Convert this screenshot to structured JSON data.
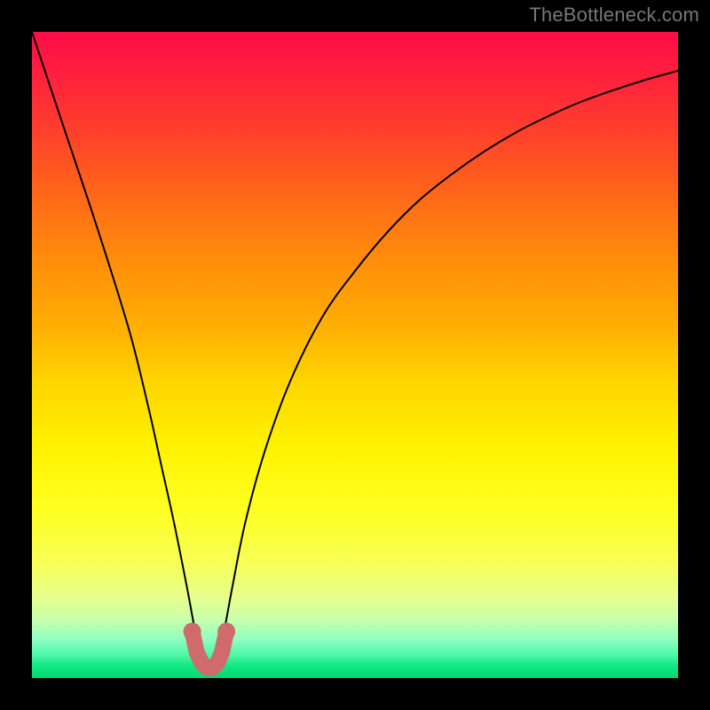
{
  "watermark": "TheBottleneck.com",
  "chart_data": {
    "type": "line",
    "title": "",
    "xlabel": "",
    "ylabel": "",
    "xlim": [
      0,
      100
    ],
    "ylim": [
      0,
      100
    ],
    "grid": false,
    "series": [
      {
        "name": "bottleneck-curve",
        "x": [
          0,
          5,
          10,
          15,
          18,
          20,
          22,
          24,
          25.5,
          26.5,
          27.5,
          28.5,
          29.5,
          31,
          33,
          36,
          40,
          45,
          50,
          55,
          60,
          65,
          70,
          75,
          80,
          85,
          90,
          95,
          100
        ],
        "values": [
          100,
          85,
          70,
          54,
          42,
          33,
          24,
          14,
          6,
          2.2,
          1.4,
          2.2,
          6,
          14,
          24,
          35,
          46,
          56,
          63,
          69,
          74,
          78,
          81.5,
          84.5,
          87,
          89.2,
          91,
          92.6,
          94
        ]
      },
      {
        "name": "highlight-marker",
        "x": [
          24.8,
          25.5,
          26.3,
          27.1,
          27.9,
          28.7,
          29.4,
          30.1
        ],
        "values": [
          7.2,
          4.0,
          2.3,
          1.6,
          1.6,
          2.3,
          4.0,
          7.2
        ]
      }
    ],
    "colors": {
      "curve": "#000000",
      "marker": "#cf6b6b",
      "background_top": "#ff0b46",
      "background_mid": "#ffe600",
      "background_bottom": "#00d872"
    }
  }
}
